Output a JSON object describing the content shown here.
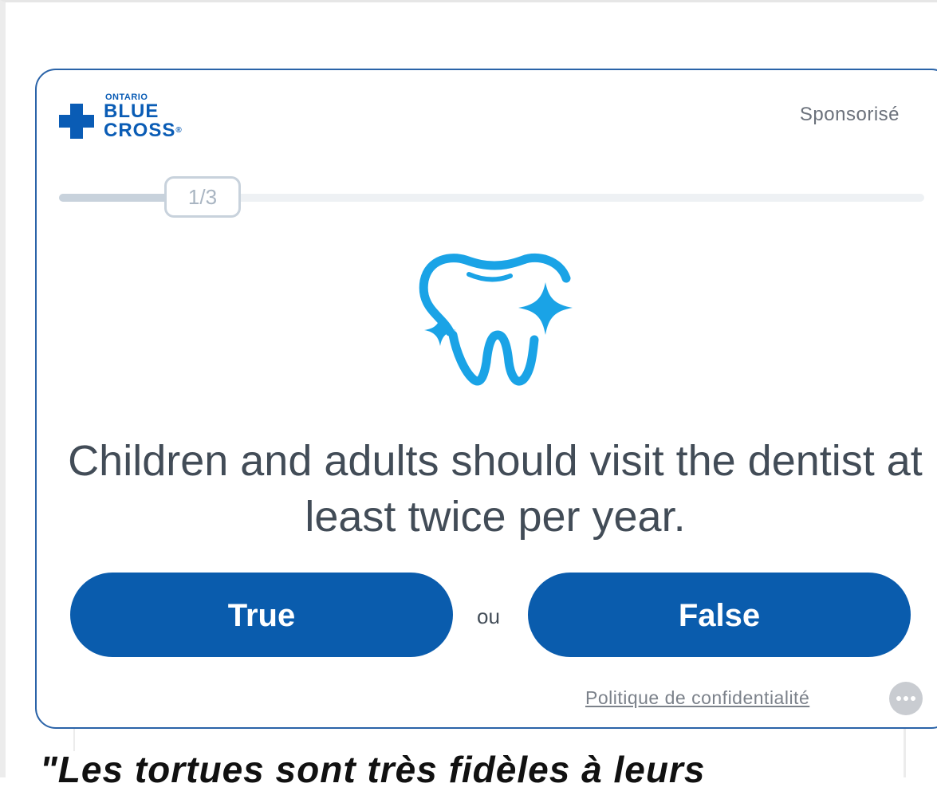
{
  "ad": {
    "brand": {
      "small": "ONTARIO",
      "line1": "BLUE",
      "line2": "CROSS",
      "registered": "®",
      "color": "#0a5cb5"
    },
    "sponsored_label": "Sponsorisé",
    "progress": {
      "label": "1/3",
      "current": 1,
      "total": 3
    },
    "question": "Children and adults should visit the dentist at least twice per year.",
    "buttons": {
      "true_label": "True",
      "or_label": "ou",
      "false_label": "False",
      "color": "#0a5cad"
    },
    "privacy_link": "Politique de confidentialité",
    "icons": {
      "illustration": "tooth-sparkle-icon",
      "menu": "more-options-icon"
    },
    "accent_color": "#1aa3e6"
  },
  "article": {
    "heading": "\"Les tortues sont très fidèles à leurs"
  }
}
